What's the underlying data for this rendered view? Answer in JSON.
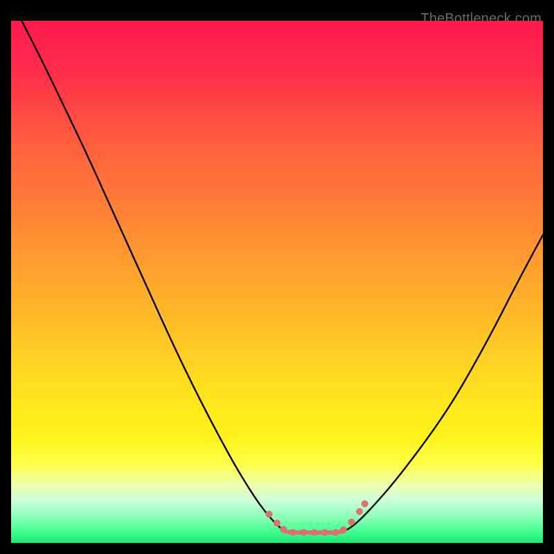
{
  "watermark": "TheBottleneck.com",
  "chart_data": {
    "type": "line",
    "title": "",
    "xlabel": "",
    "ylabel": "",
    "xlim": [
      0,
      100
    ],
    "ylim": [
      0,
      100
    ],
    "grid": false,
    "series": [
      {
        "name": "left-curve",
        "stroke": "#000000",
        "x": [
          2,
          6,
          10,
          14,
          18,
          22,
          26,
          30,
          34,
          38,
          42,
          45,
          47,
          49,
          50.5,
          51.5
        ],
        "y": [
          100,
          92,
          83.5,
          75,
          66,
          57,
          48,
          39,
          30.5,
          22.5,
          15,
          10,
          7,
          4.5,
          3,
          2.2
        ]
      },
      {
        "name": "right-curve",
        "stroke": "#000000",
        "x": [
          62.5,
          64,
          66,
          68.5,
          71.5,
          75,
          79,
          83,
          87,
          91,
          95,
          100
        ],
        "y": [
          2.2,
          3,
          4.8,
          7.5,
          11,
          15.5,
          21,
          27,
          34,
          41.5,
          49.5,
          59
        ]
      },
      {
        "name": "flat-bottom",
        "stroke": "#e16f6f",
        "x": [
          51.5,
          53,
          55,
          57,
          59,
          61,
          62.5
        ],
        "y": [
          2.2,
          2,
          2,
          2,
          2,
          2,
          2.2
        ]
      }
    ],
    "markers": [
      {
        "x": 48.5,
        "y": 5.5,
        "r": 5,
        "fill": "#e16f6f"
      },
      {
        "x": 50.0,
        "y": 3.8,
        "r": 5,
        "fill": "#e16f6f"
      },
      {
        "x": 51.2,
        "y": 2.6,
        "r": 5,
        "fill": "#e16f6f"
      },
      {
        "x": 53.0,
        "y": 2.0,
        "r": 5,
        "fill": "#e16f6f"
      },
      {
        "x": 55.0,
        "y": 2.0,
        "r": 5,
        "fill": "#e16f6f"
      },
      {
        "x": 57.0,
        "y": 2.0,
        "r": 5,
        "fill": "#e16f6f"
      },
      {
        "x": 59.0,
        "y": 2.0,
        "r": 5,
        "fill": "#e16f6f"
      },
      {
        "x": 61.0,
        "y": 2.0,
        "r": 5,
        "fill": "#e16f6f"
      },
      {
        "x": 62.5,
        "y": 2.5,
        "r": 5,
        "fill": "#e16f6f"
      },
      {
        "x": 64.0,
        "y": 4.0,
        "r": 5,
        "fill": "#e16f6f"
      },
      {
        "x": 65.5,
        "y": 6.0,
        "r": 5,
        "fill": "#e16f6f"
      },
      {
        "x": 66.5,
        "y": 7.5,
        "r": 5,
        "fill": "#e16f6f"
      }
    ],
    "background_gradient": {
      "stops": [
        {
          "offset": 0.0,
          "color": "#ff1a4f"
        },
        {
          "offset": 0.1,
          "color": "#ff2e4b"
        },
        {
          "offset": 0.22,
          "color": "#ff5a3f"
        },
        {
          "offset": 0.35,
          "color": "#ff7d36"
        },
        {
          "offset": 0.48,
          "color": "#ffa22d"
        },
        {
          "offset": 0.6,
          "color": "#ffc324"
        },
        {
          "offset": 0.72,
          "color": "#ffe41e"
        },
        {
          "offset": 0.8,
          "color": "#fff31c"
        },
        {
          "offset": 0.85,
          "color": "#fdff4a"
        },
        {
          "offset": 0.89,
          "color": "#efffb0"
        },
        {
          "offset": 0.92,
          "color": "#c9ffdb"
        },
        {
          "offset": 0.95,
          "color": "#8dffb9"
        },
        {
          "offset": 0.975,
          "color": "#4Bff95"
        },
        {
          "offset": 1.0,
          "color": "#17e872"
        }
      ]
    }
  }
}
